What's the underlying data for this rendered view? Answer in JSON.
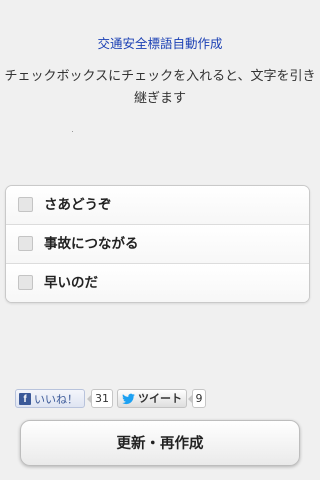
{
  "header": {
    "title": "交通安全標語自動作成",
    "instruction": "チェックボックスにチェックを入れると、文字を引き継ぎます"
  },
  "checklist": {
    "items": [
      {
        "label": "さあどうぞ",
        "checked": false
      },
      {
        "label": "事故につながる",
        "checked": false
      },
      {
        "label": "早いのだ",
        "checked": false
      }
    ]
  },
  "social": {
    "facebook_icon": "f",
    "facebook_like_label": "いいね！",
    "facebook_like_count": "31",
    "tweet_label": "ツイート",
    "tweet_count": "9"
  },
  "actions": {
    "refresh_label": "更新・再作成"
  },
  "colors": {
    "title": "#1a3fb4",
    "background": "#f0f0f0",
    "facebook": "#3b5998",
    "twitter": "#1da1f2"
  },
  "icons": {
    "facebook": "facebook-icon",
    "twitter": "twitter-bird-icon"
  }
}
